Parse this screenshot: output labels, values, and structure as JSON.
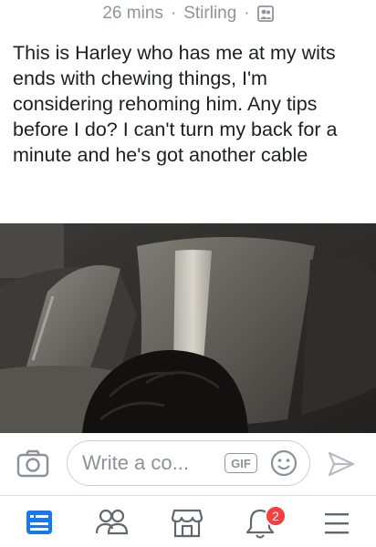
{
  "post": {
    "time": "26 mins",
    "separator": "·",
    "location": "Stirling",
    "audience_icon": "friends-audience-icon",
    "text": "This is Harley who has me at my wits ends with chewing things, I'm considering rehoming him. Any tips before I do? I can't turn my back for a minute and he's got another cable"
  },
  "composer": {
    "placeholder": "Write a co...",
    "gif_label": "GIF",
    "camera_icon": "camera-icon",
    "emoji_icon": "smiley-icon",
    "send_icon": "send-icon"
  },
  "tabbar": {
    "items": [
      {
        "icon": "news-feed-icon",
        "active": true
      },
      {
        "icon": "friends-icon",
        "active": false
      },
      {
        "icon": "marketplace-icon",
        "active": false
      },
      {
        "icon": "notifications-icon",
        "active": false
      },
      {
        "icon": "menu-icon",
        "active": false
      }
    ],
    "notification_count": "2"
  },
  "colors": {
    "accent": "#1877f2",
    "badge": "#fa3e3e",
    "muted": "#8f949c"
  }
}
